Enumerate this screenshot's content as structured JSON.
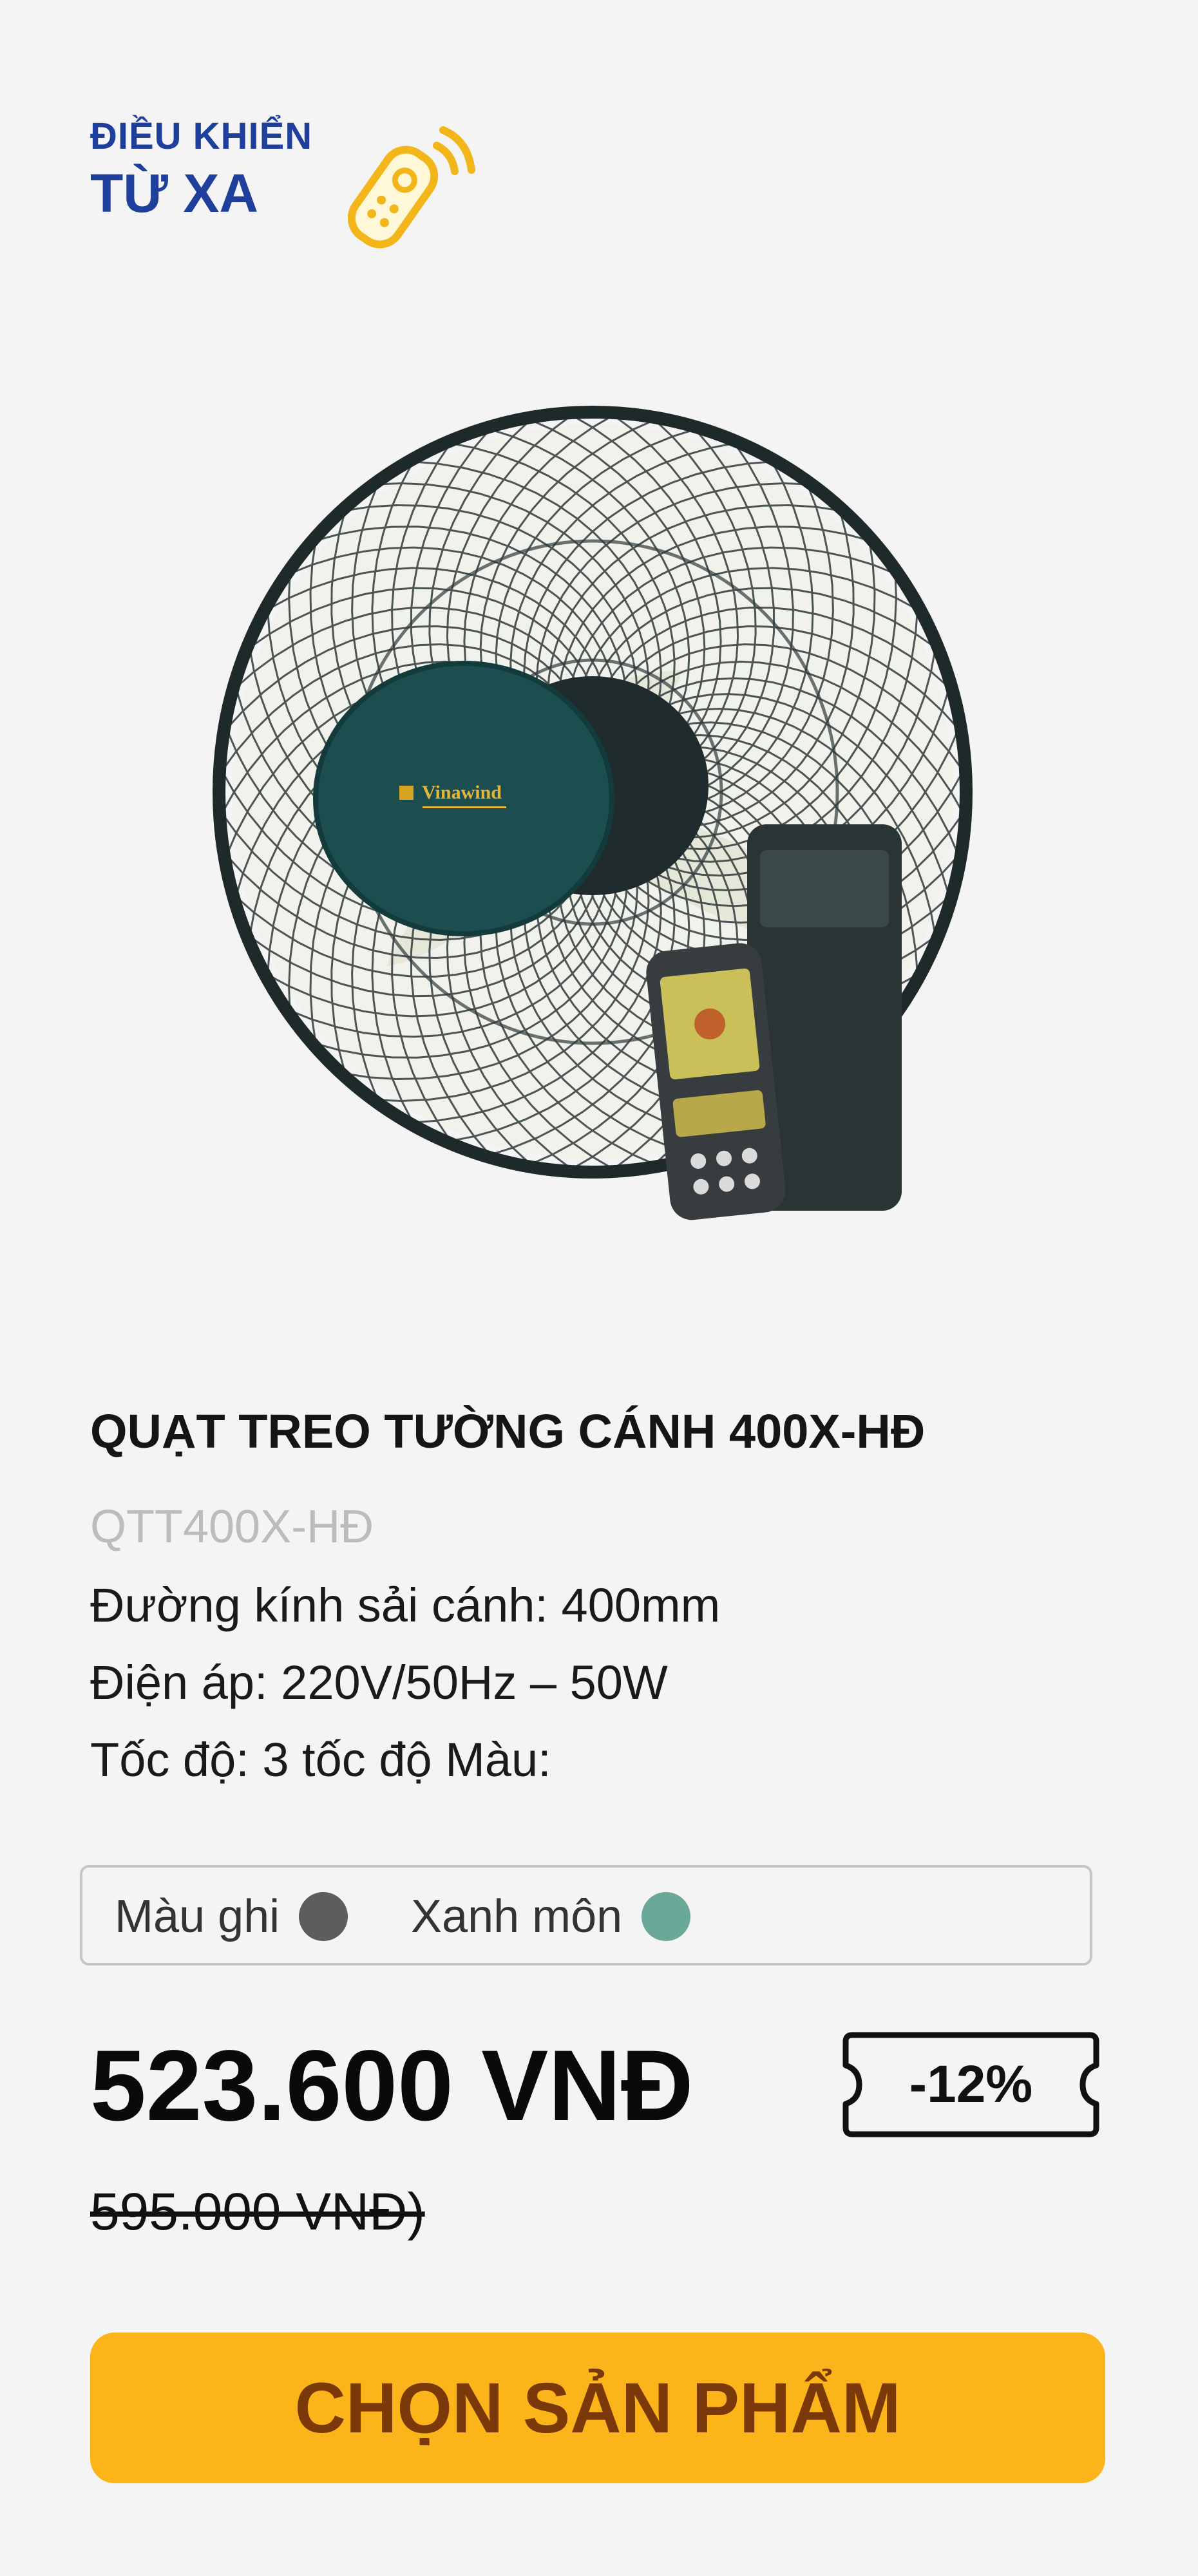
{
  "badge": {
    "line1": "ĐIỀU KHIỂN",
    "line2": "TỪ XA"
  },
  "product": {
    "brand_logo": "Vinawind",
    "title": "QUẠT TREO TƯỜNG CÁNH 400X-HĐ",
    "sku": "QTT400X-HĐ",
    "specs": [
      "Đường kính sải cánh: 400mm",
      "Điện áp: 220V/50Hz – 50W",
      "Tốc độ: 3 tốc độ Màu:"
    ]
  },
  "colors": [
    {
      "label": "Màu ghi",
      "swatch": "#5d5d5d"
    },
    {
      "label": "Xanh môn",
      "swatch": "#6aa898"
    }
  ],
  "pricing": {
    "price": "523.600 VNĐ",
    "old_price": "595.000 VNĐ)",
    "discount": "-12%"
  },
  "cta": {
    "label": "CHỌN SẢN PHẨM"
  },
  "theme": {
    "accent": "#fbb51a",
    "accent_text": "#7b3809",
    "badge_blue": "#1f3f9c"
  },
  "icons": [
    "remote-control-icon",
    "signal-waves-icon"
  ]
}
